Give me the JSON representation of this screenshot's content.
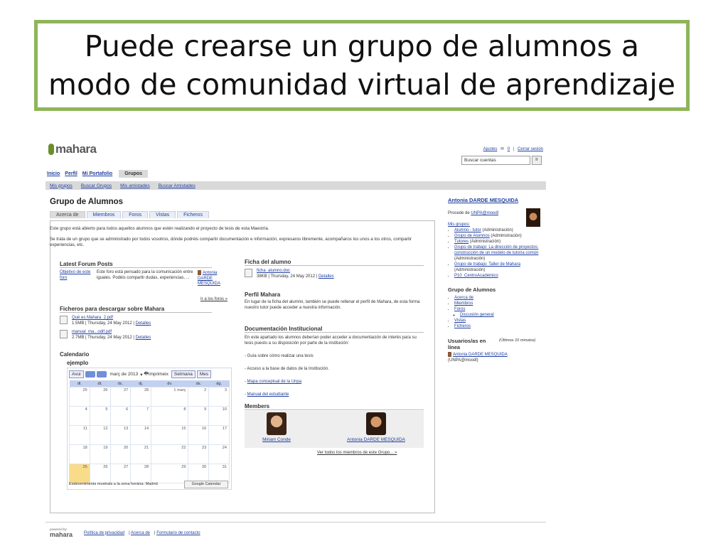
{
  "slide": {
    "title_line1": "Puede crearse un grupo de alumnos a",
    "title_line2": "modo de comunidad virtual de aprendizaje",
    "border_color": "#8fb55a"
  },
  "app": {
    "logo": "mahara",
    "toplinks": [
      "Ajustes",
      "0",
      "Cerrar sesión"
    ],
    "search_placeholder": "Buscar cuentas",
    "search_button": "Ir",
    "main_nav": [
      "Inicio",
      "Perfil",
      "Mi Portafolio",
      "Grupos"
    ],
    "sub_nav": [
      "Mis grupos",
      "Buscar Grupos",
      "Mis amistades",
      "Buscar Amistades"
    ]
  },
  "group": {
    "title": "Grupo de Alumnos",
    "tabs": [
      "Acerca de",
      "Miembros",
      "Foros",
      "Vistas",
      "Ficheros"
    ],
    "intro_p1": "Este grupo está abierto para todos aquellos alumnos que estén realizando el proyecto de tesis de esta Maestría.",
    "intro_p2": "Se trata de un grupo que se administrado por todos vosotros, dónde podréis compartir documentación e información, expresaros libremente, acompañaros los unos a los otros, compartir experiencias, etc."
  },
  "forum": {
    "heading": "Latest Forum Posts",
    "topic": "Objetivo de este foro",
    "text": "Este foro está pensado para la comunicación entre iguales. Podéis compartir dudas, experiencias, ...",
    "author": "Antonia DARDE MESQUIDA",
    "more": "Ir a los foros »"
  },
  "files": {
    "heading": "Ficheros para descargar sobre Mahara",
    "items": [
      {
        "name": "Qué es Mahara_2.pdf",
        "meta": "1.5MB | Thursday, 24 May 2012 |",
        "details": "Detalles"
      },
      {
        "name": "manual_ma...odif.pdf",
        "meta": "2.7MB | Thursday, 24 May 2012 |",
        "details": "Detalles"
      }
    ]
  },
  "calendar": {
    "heading": "Calendario",
    "name": "ejemplo",
    "today_btn": "Avui",
    "month": "març de 2013",
    "print": "Imprimeix",
    "week": "Setmana",
    "month_btn": "Mes",
    "days": [
      "dl.",
      "dt.",
      "dc.",
      "dj.",
      "dv.",
      "ds.",
      "dg."
    ],
    "rows": [
      [
        "25",
        "26",
        "27",
        "28",
        "1 març",
        "2",
        "3"
      ],
      [
        "4",
        "5",
        "6",
        "7",
        "8",
        "9",
        "10"
      ],
      [
        "11",
        "12",
        "13",
        "14",
        "15",
        "16",
        "17"
      ],
      [
        "18",
        "19",
        "20",
        "21",
        "22",
        "23",
        "24"
      ],
      [
        "25",
        "26",
        "27",
        "28",
        "29",
        "30",
        "31"
      ]
    ],
    "footer": "Esdeveniments mostrats a la zona horària: Madrid",
    "gcal": "Google Calendar"
  },
  "ficha": {
    "heading": "Ficha del alumno",
    "file": "ficha_alumno.doc",
    "meta": "38KB | Thursday, 24 May 2012 |",
    "details": "Detalles"
  },
  "perfil": {
    "heading": "Perfil Mahara",
    "text": "En lugar de la ficha del alumno, también se puede rellenar el perfil de Mahara, de esta forma nuestro tutor puede acceder a nuestra información."
  },
  "doc": {
    "heading": "Documentación Institucional",
    "text": "En este apartado los alumnos deberían poder acceder a documentación de interés para su tesis puesto a su disposición por parte de la institución:",
    "items": [
      "- Guía sobre cómo realizar una tesis",
      "- Acceso a la base de datos de la Institución.",
      "Mapa conceptual de la Unpa",
      "Manual del estudiante"
    ]
  },
  "members": {
    "heading": "Members",
    "names": [
      "Miriam Conde",
      "Antonia DARDE MESQUIDA"
    ],
    "all": "Ver todos los miembros de este Grupo... »"
  },
  "sidebar": {
    "user": "Antonia DARDE MESQUIDA",
    "from_label": "Procede de",
    "from": "UNPA@moodl",
    "groups_label": "Mis grupos:",
    "groups": [
      {
        "name": "Alumno - tutor",
        "role": "(Administración)"
      },
      {
        "name": "Grupo de Alumnos",
        "role": "(Administración)"
      },
      {
        "name": "Tutores",
        "role": "(Administración)"
      },
      {
        "name": "Grupo de trabajo: La dirección de proyectos: construcción de un modelo de tutoría común",
        "role": "(Administración)"
      },
      {
        "name": "Grupo de trabajo: Taller de Mahara",
        "role": "(Administración)"
      },
      {
        "name": "P10_CentroAcadémico",
        "role": ""
      }
    ],
    "group_menu_heading": "Grupo de Alumnos",
    "group_menu": [
      "Acerca de",
      "Miembros",
      "Foros",
      "Vistas",
      "Ficheros"
    ],
    "forum_sub": "Discusión general",
    "online_heading": "Usuarios/as en línea",
    "online_note": "(Últimos 10 minutos)",
    "online_user": "Antonia DARDE MESQUIDA",
    "online_from": "(UNPA@moodl)"
  },
  "footer": {
    "powered": "powered by",
    "logo": "mahara",
    "links": [
      "Política de privacidad",
      "Acerca de",
      "Formulario de contacto"
    ]
  }
}
